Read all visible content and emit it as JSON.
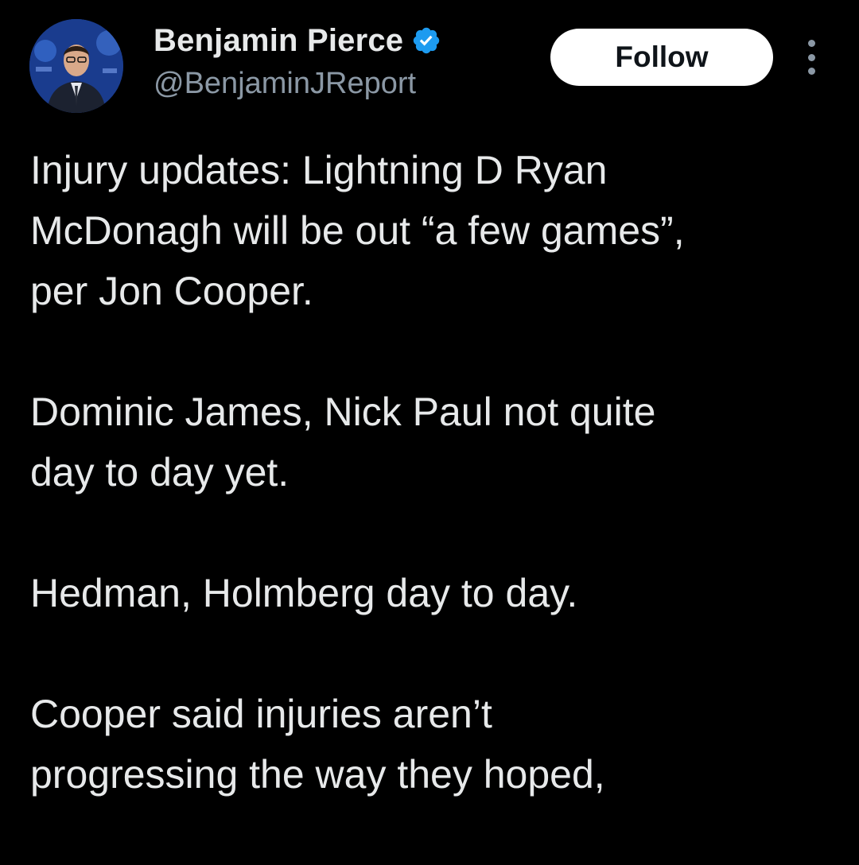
{
  "author": {
    "display_name": "Benjamin Pierce",
    "handle": "@BenjaminJReport",
    "verified": true,
    "avatar_icon": "profile-photo"
  },
  "actions": {
    "follow_label": "Follow",
    "more_icon": "more-options-icon"
  },
  "post": {
    "paragraphs": [
      {
        "lines": [
          "Injury updates: Lightning D Ryan",
          "McDonagh will be out “a few games”,",
          "per Jon Cooper."
        ]
      },
      {
        "lines": [
          "Dominic James, Nick Paul not quite",
          "day to day yet."
        ]
      },
      {
        "lines": [
          "Hedman, Holmberg day to day."
        ]
      },
      {
        "lines": [
          "Cooper said injuries aren’t",
          "progressing the way they hoped,"
        ]
      }
    ]
  },
  "colors": {
    "background": "#000000",
    "text_primary": "#e7e9ea",
    "text_secondary": "#8b98a5",
    "verified_blue": "#1d9bf0",
    "follow_bg": "#ffffff"
  }
}
